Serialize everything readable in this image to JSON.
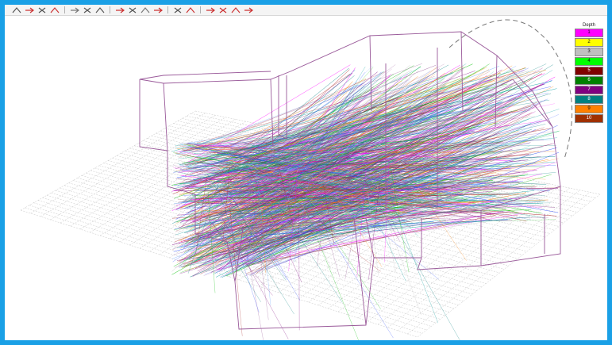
{
  "legend": {
    "title": "Depth",
    "items": [
      {
        "label": "1",
        "color": "#ff00ff"
      },
      {
        "label": "2",
        "color": "#ffff00"
      },
      {
        "label": "3",
        "color": "#c0c0c0"
      },
      {
        "label": "4",
        "color": "#00ff00"
      },
      {
        "label": "5",
        "color": "#800000"
      },
      {
        "label": "6",
        "color": "#008000"
      },
      {
        "label": "7",
        "color": "#800080"
      },
      {
        "label": "8",
        "color": "#008080"
      },
      {
        "label": "9",
        "color": "#ff8000"
      },
      {
        "label": "10",
        "color": "#a03000"
      }
    ]
  },
  "toolbar": {
    "buttons": [
      {
        "name": "rotate-tool-button",
        "icon": "rotate-icon"
      },
      {
        "name": "zoom-tool-button",
        "icon": "zoom-icon"
      },
      {
        "name": "pan-tool-button",
        "icon": "pan-icon"
      },
      {
        "name": "select-tool-button",
        "icon": "pointer-icon"
      },
      {
        "name": "view-front-button",
        "icon": "view-front-icon"
      },
      {
        "name": "view-top-button",
        "icon": "view-top-icon"
      },
      {
        "name": "view-side-button",
        "icon": "view-side-icon"
      },
      {
        "name": "source-button",
        "icon": "source-icon"
      },
      {
        "name": "receiver-button",
        "icon": "receiver-icon"
      },
      {
        "name": "ray-button",
        "icon": "ray-icon"
      },
      {
        "name": "reflect-button",
        "icon": "reflect-icon"
      },
      {
        "name": "grid-button",
        "icon": "grid-icon"
      },
      {
        "name": "wire-button",
        "icon": "wireframe-icon"
      },
      {
        "name": "prev-button",
        "icon": "arrow-left-icon"
      },
      {
        "name": "next-button",
        "icon": "arrow-right-icon"
      },
      {
        "name": "first-button",
        "icon": "first-icon"
      },
      {
        "name": "last-button",
        "icon": "last-icon"
      }
    ]
  },
  "colors": {
    "frame_border": "#1aa0e6",
    "wireframe": "#9a5a9a",
    "grid": "#b8b8b8"
  }
}
